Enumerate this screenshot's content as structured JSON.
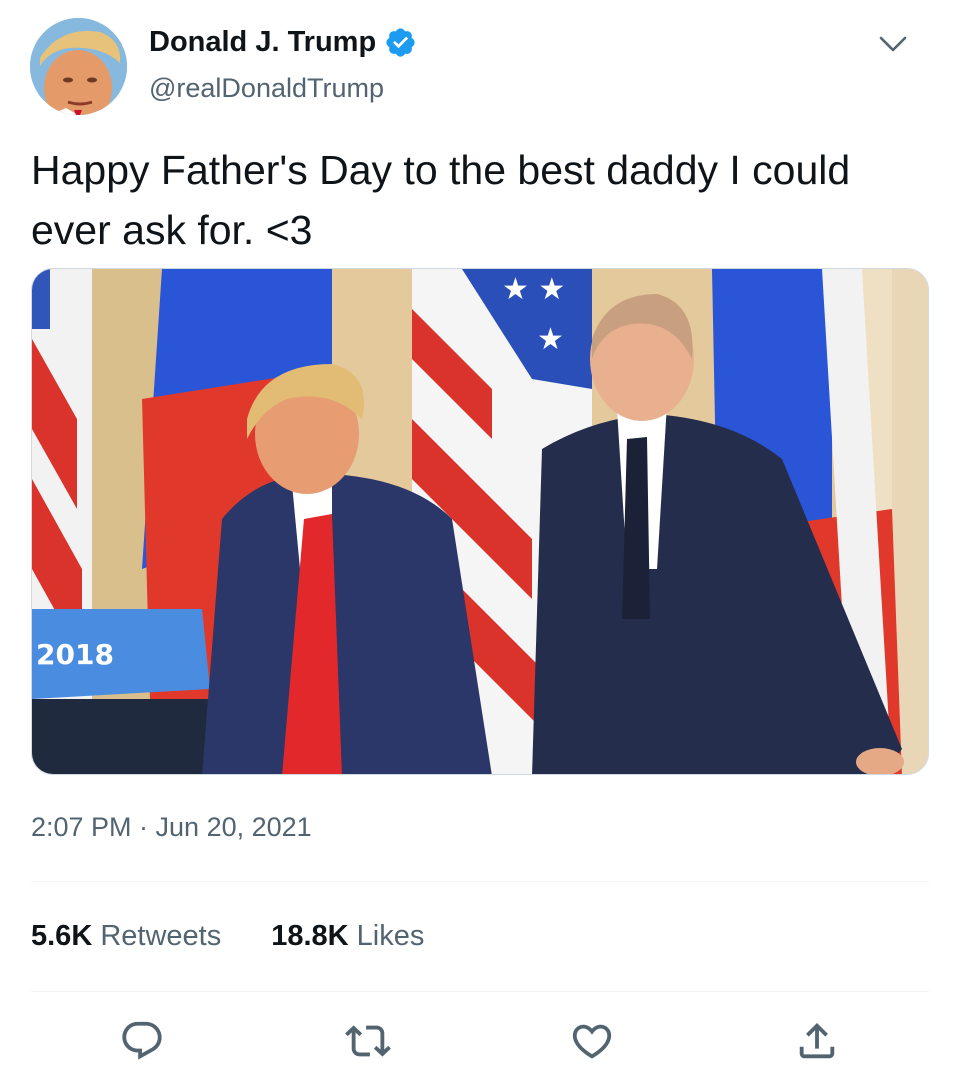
{
  "author": {
    "name": "Donald J. Trump",
    "handle": "@realDonaldTrump",
    "verified": true
  },
  "tweet": {
    "text": "Happy Father's Day to the best daddy I could ever ask for. <3",
    "image_podium_text": "2018"
  },
  "meta": {
    "timestamp": "2:07 PM · Jun 20, 2021"
  },
  "stats": {
    "retweets_count": "5.6K",
    "retweets_label": "Retweets",
    "likes_count": "18.8K",
    "likes_label": "Likes"
  },
  "icons": {
    "verified": "verified-badge-icon",
    "menu": "chevron-down-icon",
    "reply": "reply-icon",
    "retweet": "retweet-icon",
    "like": "heart-icon",
    "share": "share-icon"
  },
  "colors": {
    "verified_blue": "#1d9bf0",
    "text_primary": "#0f1419",
    "text_secondary": "#536471",
    "divider": "#eff3f4"
  }
}
